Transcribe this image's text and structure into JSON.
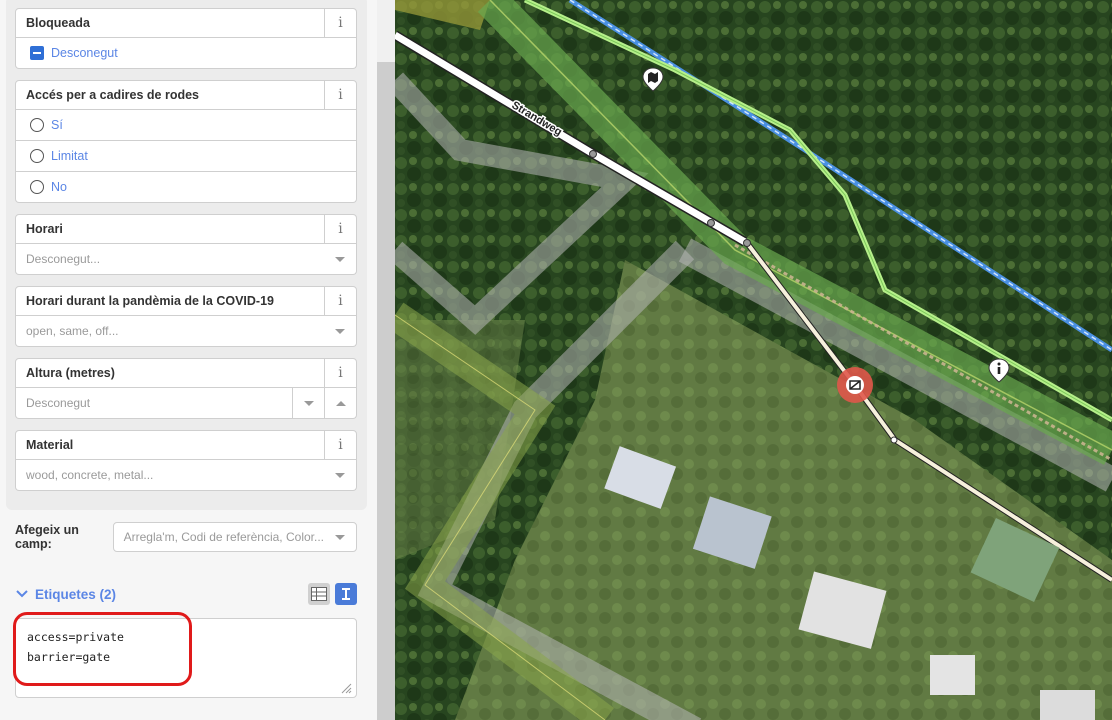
{
  "fields": {
    "bloqueada": {
      "label": "Bloqueada",
      "value": "Desconegut"
    },
    "wheelchair": {
      "label": "Accés per a cadires de rodes",
      "options": [
        "Sí",
        "Limitat",
        "No"
      ]
    },
    "horari": {
      "label": "Horari",
      "placeholder": "Desconegut..."
    },
    "covid": {
      "label": "Horari durant la pandèmia de la COVID-19",
      "placeholder": "open, same, off..."
    },
    "altura": {
      "label": "Altura (metres)",
      "placeholder": "Desconegut"
    },
    "material": {
      "label": "Material",
      "placeholder": "wood, concrete, metal..."
    }
  },
  "info_glyph": "i",
  "add_field": {
    "label": "Afegeix un camp:",
    "placeholder": "Arregla'm, Codi de referència, Color..."
  },
  "tags": {
    "title": "Etiquetes (2)",
    "text": "access=private\nbarrier=gate"
  },
  "map": {
    "street_label": "Strandweg",
    "vertex_icon": "gate-icon",
    "poi_icons": [
      "map-icon",
      "info-icon"
    ]
  },
  "colors": {
    "accent": "#5b86e5",
    "highlight_ring": "#e01a1a",
    "selected_vertex": "#e0574a",
    "green_area": "#6aa84f",
    "blue_line": "#4a90e2"
  },
  "icons": {
    "info": "info-icon",
    "checkbox": "minus-checkbox-icon",
    "radio": "radio-icon",
    "caret": "chevron-down-icon",
    "tags_toggle": "chevron-down-icon",
    "list_view": "list-view-icon",
    "text_view": "text-view-icon",
    "resize": "resize-grip-icon"
  }
}
